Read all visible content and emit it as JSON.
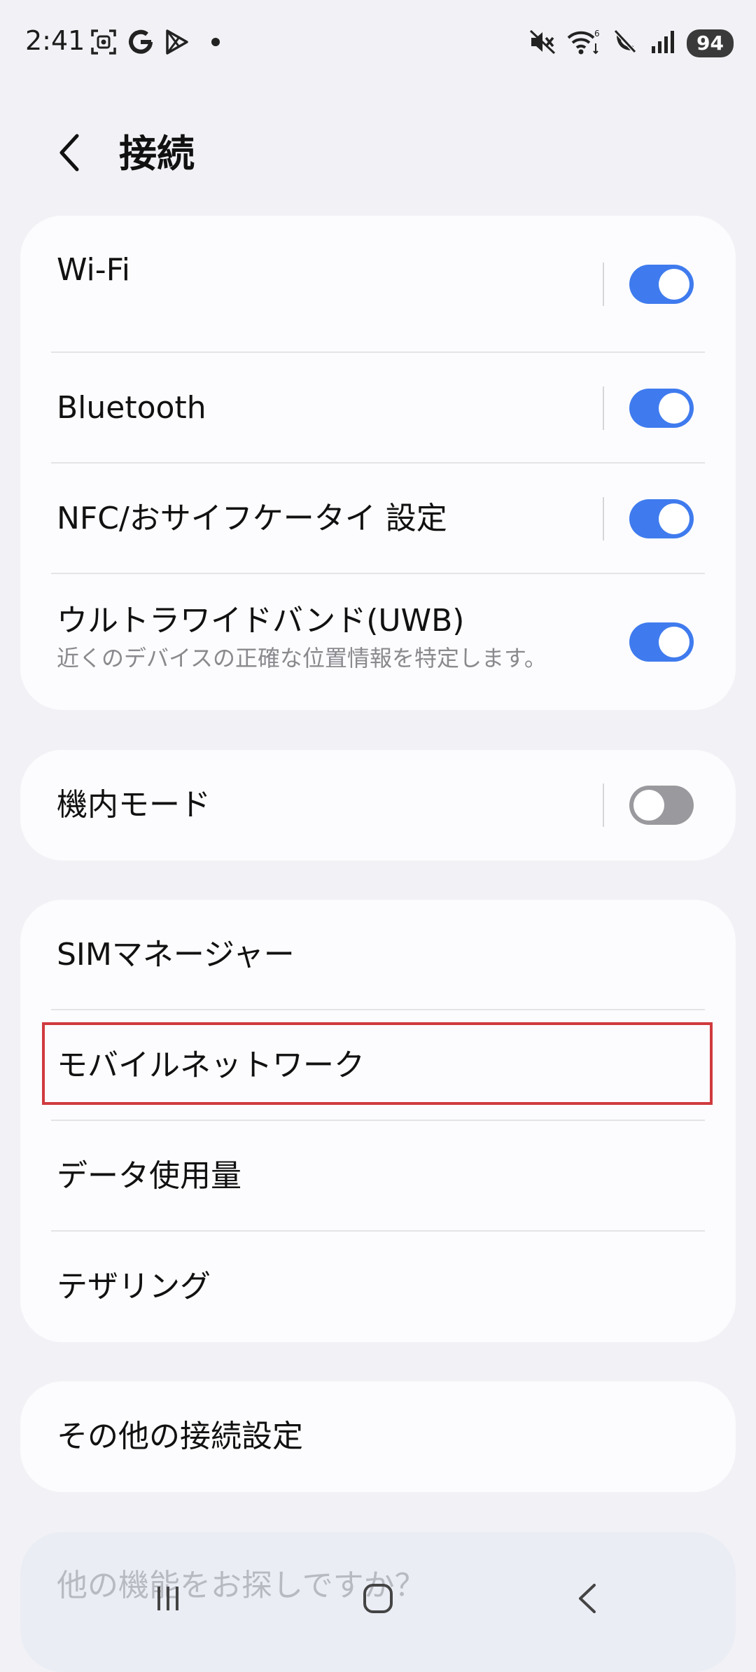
{
  "status_bar": {
    "time": "2:41",
    "left_icons": [
      "screenshot-icon",
      "google-icon",
      "play-store-icon",
      "dot-icon"
    ],
    "right_icons": [
      "mute-icon",
      "wifi-icon",
      "call-off-icon",
      "signal-icon"
    ],
    "battery": "94"
  },
  "header": {
    "title": "接続"
  },
  "sections": [
    {
      "items": [
        {
          "title": "Wi-Fi",
          "subtitle": "",
          "toggle": "on",
          "separator": true
        },
        {
          "title": "Bluetooth",
          "subtitle": "",
          "toggle": "on",
          "separator": true
        },
        {
          "title": "NFC/おサイフケータイ 設定",
          "subtitle": "",
          "toggle": "on",
          "separator": true
        },
        {
          "title": "ウルトラワイドバンド(UWB)",
          "subtitle": "近くのデバイスの正確な位置情報を特定します。",
          "toggle": "on",
          "separator": false
        }
      ]
    },
    {
      "items": [
        {
          "title": "機内モード",
          "subtitle": "",
          "toggle": "off",
          "separator": true
        }
      ]
    },
    {
      "items": [
        {
          "title": "SIMマネージャー"
        },
        {
          "title": "モバイルネットワーク",
          "highlighted": true
        },
        {
          "title": "データ使用量"
        },
        {
          "title": "テザリング"
        }
      ]
    },
    {
      "items": [
        {
          "title": "その他の接続設定"
        }
      ]
    }
  ],
  "suggestion": {
    "text": "他の機能をお探しですか？"
  },
  "colors": {
    "toggle_on": "#3f7bee",
    "toggle_off": "#9a9a9e",
    "highlight": "#d03a3e",
    "background": "#f2f2f6",
    "card": "#fcfcfe"
  },
  "nav": {
    "icons": [
      "recents-icon",
      "home-icon",
      "back-icon"
    ]
  }
}
